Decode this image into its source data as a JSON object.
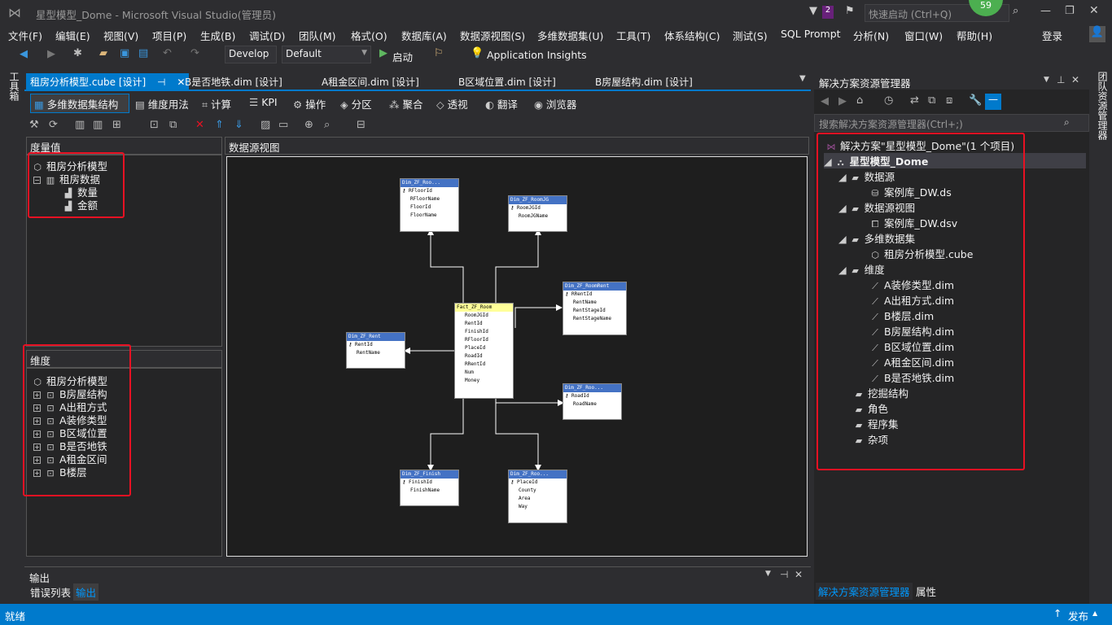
{
  "titlebar": {
    "title": "星型模型_Dome - Microsoft Visual Studio(管理员)",
    "notif_count": "2",
    "quick_launch_placeholder": "快速启动 (Ctrl+Q)",
    "account_badge": "59"
  },
  "menu": [
    "文件(F)",
    "编辑(E)",
    "视图(V)",
    "项目(P)",
    "生成(B)",
    "调试(D)",
    "团队(M)",
    "格式(O)",
    "数据库(A)",
    "数据源视图(S)",
    "多维数据集(U)",
    "工具(T)",
    "体系结构(C)",
    "测试(S)",
    "SQL Prompt",
    "分析(N)",
    "窗口(W)",
    "帮助(H)"
  ],
  "login": "登录",
  "toolbar": {
    "config": "Develop",
    "platform": "Default",
    "start": "启动",
    "insights": "Application Insights"
  },
  "left_tool": "工具箱",
  "right_tool": "团队资源管理器",
  "doc_tabs": [
    "租房分析模型.cube [设计]",
    "B是否地铁.dim [设计]",
    "A租金区间.dim [设计]",
    "B区域位置.dim [设计]",
    "B房屋结构.dim [设计]"
  ],
  "design_tabs": [
    "多维数据集结构",
    "维度用法",
    "计算",
    "KPI",
    "操作",
    "分区",
    "聚合",
    "透视",
    "翻译",
    "浏览器"
  ],
  "measures": {
    "header": "度量值",
    "root": "租房分析模型",
    "group": "租房数据",
    "items": [
      "数量",
      "金额"
    ]
  },
  "dimensions": {
    "header": "维度",
    "root": "租房分析模型",
    "items": [
      "B房屋结构",
      "A出租方式",
      "A装修类型",
      "B区域位置",
      "B是否地铁",
      "A租金区间",
      "B楼层"
    ]
  },
  "dsv": {
    "header": "数据源视图",
    "tables": [
      {
        "name": "Dim_ZF_Roo...",
        "cols": [
          "RFloorId",
          "RFloorName",
          "FloorId",
          "FloorName"
        ]
      },
      {
        "name": "Dim_ZF_RoomJG",
        "cols": [
          "RoomJGId",
          "RoomJGName"
        ]
      },
      {
        "name": "Dim_ZF_RoomRent",
        "cols": [
          "RRentId",
          "RentName",
          "RentStageId",
          "RentStageName"
        ]
      },
      {
        "name": "Fact_ZF_Room",
        "cols": [
          "RoomJGId",
          "RentId",
          "FinishId",
          "RFloorId",
          "PlaceId",
          "RoadId",
          "RRentId",
          "Num",
          "Money"
        ]
      },
      {
        "name": "Dim_ZF_Rent",
        "cols": [
          "RentId",
          "RentName"
        ]
      },
      {
        "name": "Dim_ZF_Roo...",
        "cols": [
          "RoadId",
          "RoadName"
        ]
      },
      {
        "name": "Dim_ZF_Finish",
        "cols": [
          "FinishId",
          "FinishName"
        ]
      },
      {
        "name": "Dim_ZF_Roo...",
        "cols": [
          "PlaceId",
          "County",
          "Area",
          "Way"
        ]
      }
    ]
  },
  "output": {
    "title": "输出",
    "tabs": [
      "错误列表",
      "输出"
    ]
  },
  "solution_explorer": {
    "title": "解决方案资源管理器",
    "search_placeholder": "搜索解决方案资源管理器(Ctrl+;)",
    "solution": "解决方案\"星型模型_Dome\"(1 个项目)",
    "project": "星型模型_Dome",
    "folders": {
      "datasource": "数据源",
      "datasource_item": "案例库_DW.ds",
      "dsv": "数据源视图",
      "dsv_item": "案例库_DW.dsv",
      "cube": "多维数据集",
      "cube_item": "租房分析模型.cube",
      "dims": "维度",
      "dim_items": [
        "A装修类型.dim",
        "A出租方式.dim",
        "B楼层.dim",
        "B房屋结构.dim",
        "B区域位置.dim",
        "A租金区间.dim",
        "B是否地铁.dim"
      ],
      "others": [
        "挖掘结构",
        "角色",
        "程序集",
        "杂项"
      ]
    },
    "bottom_tabs": [
      "解决方案资源管理器",
      "属性"
    ]
  },
  "status": {
    "left": "就绪",
    "right": "发布"
  }
}
